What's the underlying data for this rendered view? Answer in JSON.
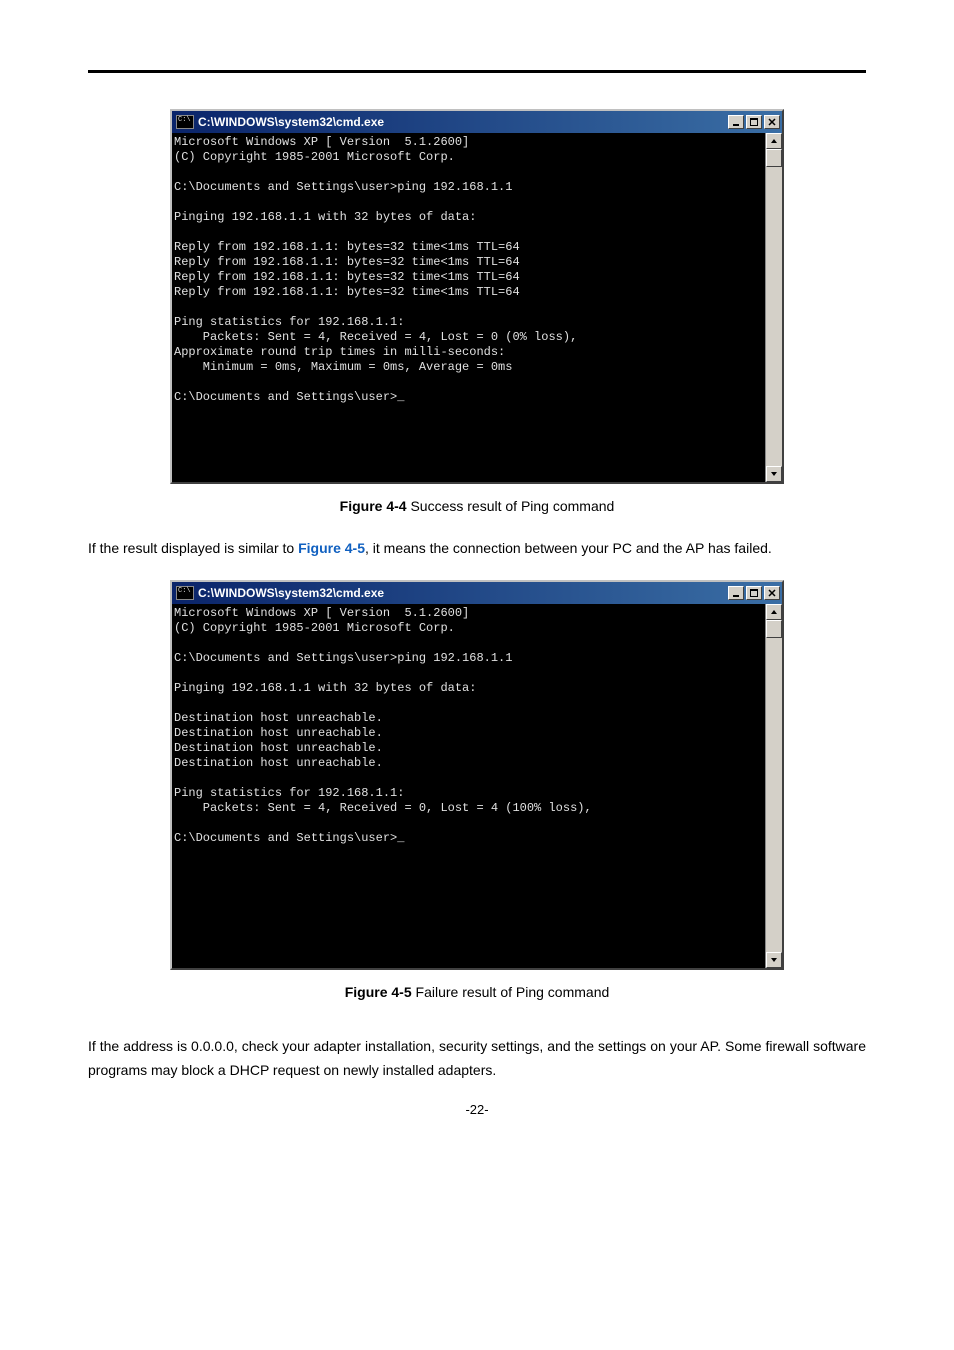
{
  "cmd1": {
    "title": "C:\\WINDOWS\\system32\\cmd.exe",
    "icon_tag": "C:\\",
    "body": "Microsoft Windows XP [ Version  5.1.2600]\n(C) Copyright 1985-2001 Microsoft Corp.\n\nC:\\Documents and Settings\\user>ping 192.168.1.1\n\nPinging 192.168.1.1 with 32 bytes of data:\n\nReply from 192.168.1.1: bytes=32 time<1ms TTL=64\nReply from 192.168.1.1: bytes=32 time<1ms TTL=64\nReply from 192.168.1.1: bytes=32 time<1ms TTL=64\nReply from 192.168.1.1: bytes=32 time<1ms TTL=64\n\nPing statistics for 192.168.1.1:\n    Packets: Sent = 4, Received = 4, Lost = 0 (0% loss),\nApproximate round trip times in milli-seconds:\n    Minimum = 0ms, Maximum = 0ms, Average = 0ms\n\nC:\\Documents and Settings\\user>_\n\n\n\n\n\n"
  },
  "figcap1": {
    "label": "Figure 4-4",
    "text": " Success result of Ping command"
  },
  "para1": {
    "pre": "If the result displayed is similar to ",
    "ref": "Figure 4-5",
    "post": ", it means the connection between your PC and the AP has failed."
  },
  "cmd2": {
    "title": "C:\\WINDOWS\\system32\\cmd.exe",
    "icon_tag": "C:\\",
    "body": "Microsoft Windows XP [ Version  5.1.2600]\n(C) Copyright 1985-2001 Microsoft Corp.\n\nC:\\Documents and Settings\\user>ping 192.168.1.1\n\nPinging 192.168.1.1 with 32 bytes of data:\n\nDestination host unreachable.\nDestination host unreachable.\nDestination host unreachable.\nDestination host unreachable.\n\nPing statistics for 192.168.1.1:\n    Packets: Sent = 4, Received = 0, Lost = 4 (100% loss),\n\nC:\\Documents and Settings\\user>_\n\n\n\n\n\n\n\n\n"
  },
  "figcap2": {
    "label": "Figure 4-5",
    "text": " Failure result of Ping command"
  },
  "para2": "If the address is 0.0.0.0, check your adapter installation, security settings, and the settings on your AP. Some firewall software programs may block a DHCP request on newly installed adapters.",
  "page_number": "-22-",
  "winbtn": {
    "min": "_",
    "max": "□",
    "close": "×"
  }
}
